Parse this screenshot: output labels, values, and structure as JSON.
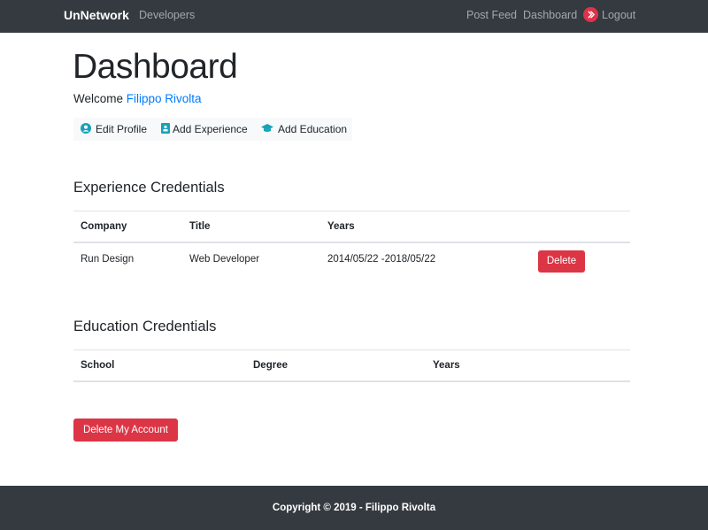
{
  "navbar": {
    "brand": "UnNetwork",
    "developers": "Developers",
    "post_feed": "Post Feed",
    "dashboard": "Dashboard",
    "logout": "Logout"
  },
  "page": {
    "title": "Dashboard",
    "welcome_prefix": "Welcome ",
    "user_name": "Filippo Rivolta"
  },
  "actions": {
    "edit_profile": "Edit Profile",
    "add_experience": "Add Experience",
    "add_education": "Add Education"
  },
  "experience": {
    "title": "Experience Credentials",
    "headers": [
      "Company",
      "Title",
      "Years",
      ""
    ],
    "rows": [
      {
        "company": "Run Design",
        "title": "Web Developer",
        "years": "2014/05/22 -2018/05/22",
        "delete_label": "Delete"
      }
    ]
  },
  "education": {
    "title": "Education Credentials",
    "headers": [
      "School",
      "Degree",
      "Years"
    ]
  },
  "delete_account_label": "Delete My Account",
  "footer": {
    "text": "Copyright © 2019 - Filippo Rivolta"
  },
  "colors": {
    "navbar_bg": "#343a40",
    "link_blue": "#007bff",
    "danger": "#dc3545",
    "info_icon": "#17a2b8",
    "logout_icon_bg": "#e0314b"
  },
  "icons": {
    "edit_profile": "user-circle-icon",
    "add_experience": "id-badge-icon",
    "add_education": "graduation-cap-icon",
    "logout": "chevron-right-circle-icon"
  }
}
